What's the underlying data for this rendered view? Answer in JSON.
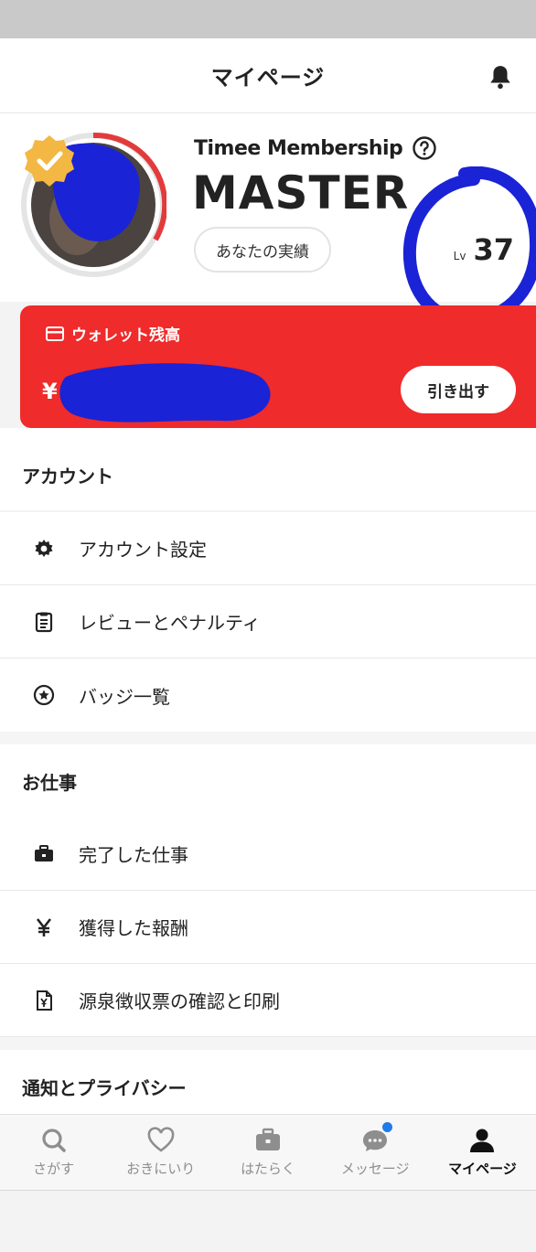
{
  "header": {
    "title": "マイページ"
  },
  "profile": {
    "membership_label": "Timee Membership",
    "rank": "MASTER",
    "record_button": "あなたの実績",
    "level_prefix": "Lv",
    "level_value": "37"
  },
  "wallet": {
    "title": "ウォレット残高",
    "currency": "¥",
    "withdraw_button": "引き出す"
  },
  "sections": {
    "account": {
      "title": "アカウント",
      "items": [
        {
          "label": "アカウント設定",
          "icon": "gear-icon"
        },
        {
          "label": "レビューとペナルティ",
          "icon": "clipboard-icon"
        },
        {
          "label": "バッジ一覧",
          "icon": "star-circle-icon"
        }
      ]
    },
    "work": {
      "title": "お仕事",
      "items": [
        {
          "label": "完了した仕事",
          "icon": "briefcase-icon"
        },
        {
          "label": "獲得した報酬",
          "icon": "yen-icon"
        },
        {
          "label": "源泉徴収票の確認と印刷",
          "icon": "document-yen-icon"
        }
      ]
    },
    "notifications": {
      "title": "通知とプライバシー"
    }
  },
  "tabbar": {
    "tabs": [
      {
        "label": "さがす",
        "icon": "search-icon"
      },
      {
        "label": "おきにいり",
        "icon": "heart-icon"
      },
      {
        "label": "はたらく",
        "icon": "briefcase-icon"
      },
      {
        "label": "メッセージ",
        "icon": "chat-icon"
      },
      {
        "label": "マイページ",
        "icon": "person-icon"
      }
    ],
    "active_index": 4
  },
  "colors": {
    "accent_red": "#ef2b2b",
    "redaction_blue": "#1a23d6",
    "notification_dot": "#1f7be8"
  }
}
